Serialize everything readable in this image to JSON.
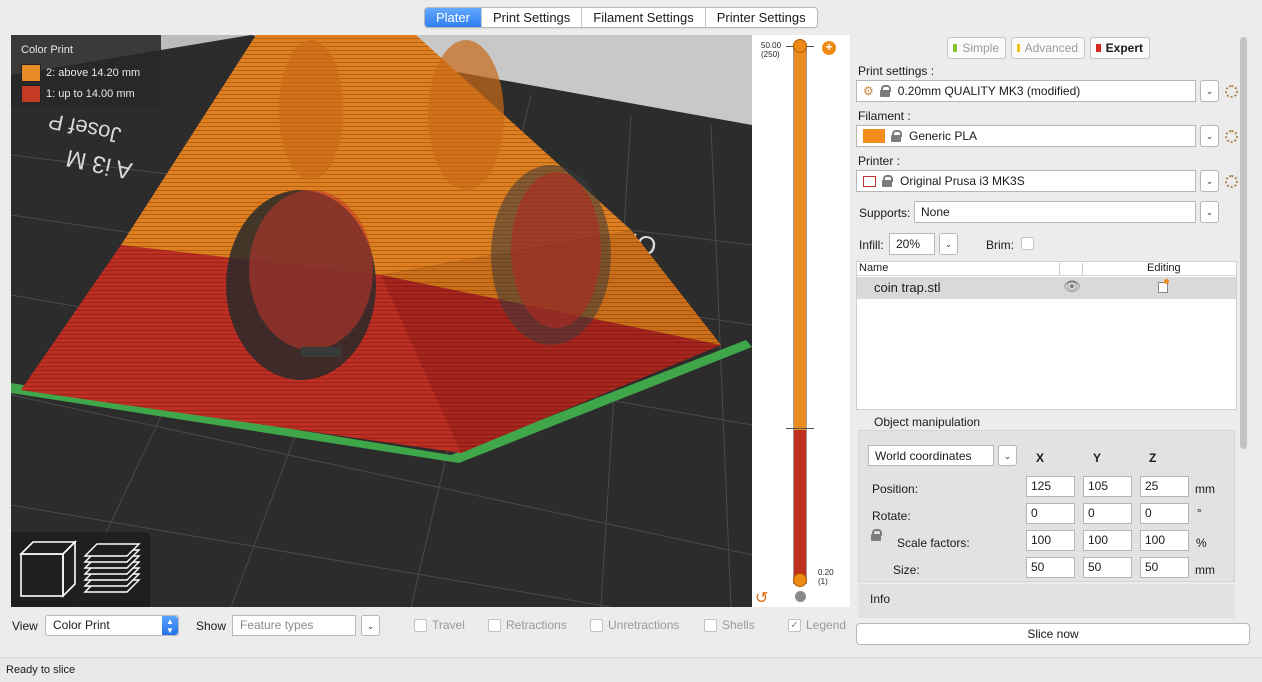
{
  "tabs": [
    "Plater",
    "Print Settings",
    "Filament Settings",
    "Printer Settings"
  ],
  "legend": {
    "title": "Color Print",
    "items": [
      {
        "label": "2: above 14.20 mm",
        "color": "#e88b26"
      },
      {
        "label": "1: up to 14.00 mm",
        "color": "#c33a25"
      }
    ]
  },
  "bed_texts": [
    "Original",
    "Josef P",
    "A i3 M"
  ],
  "slider": {
    "top_value": "50.00",
    "top_layer": "(250)",
    "bottom_value": "0.20",
    "bottom_layer": "(1)",
    "color_change_fraction": 0.714
  },
  "bottom": {
    "view_label": "View",
    "view_value": "Color Print",
    "show_label": "Show",
    "feature_placeholder": "Feature types",
    "checks": [
      {
        "label": "Travel",
        "checked": false
      },
      {
        "label": "Retractions",
        "checked": false
      },
      {
        "label": "Unretractions",
        "checked": false
      },
      {
        "label": "Shells",
        "checked": false
      },
      {
        "label": "Legend",
        "checked": true
      }
    ]
  },
  "modes": [
    {
      "label": "Simple",
      "color": "#8ac43b"
    },
    {
      "label": "Advanced",
      "color": "#f0c419"
    },
    {
      "label": "Expert",
      "color": "#d72b20"
    }
  ],
  "settings": {
    "print_label": "Print settings :",
    "print_value": "0.20mm QUALITY MK3 (modified)",
    "filament_label": "Filament :",
    "filament_value": "Generic PLA",
    "filament_color": "#f28c1b",
    "printer_label": "Printer :",
    "printer_value": "Original Prusa i3 MK3S",
    "supports_label": "Supports:",
    "supports_value": "None",
    "infill_label": "Infill:",
    "infill_value": "20%",
    "brim_label": "Brim:"
  },
  "objects": {
    "col_name": "Name",
    "col_editing": "Editing",
    "rows": [
      {
        "name": "coin trap.stl"
      }
    ]
  },
  "manipulation": {
    "title": "Object manipulation",
    "coords": "World coordinates",
    "axes": [
      "X",
      "Y",
      "Z"
    ],
    "position_label": "Position:",
    "position": [
      "125",
      "105",
      "25"
    ],
    "position_unit": "mm",
    "rotate_label": "Rotate:",
    "rotate": [
      "0",
      "0",
      "0"
    ],
    "rotate_unit": "°",
    "scale_label": "Scale factors:",
    "scale": [
      "100",
      "100",
      "100"
    ],
    "scale_unit": "%",
    "size_label": "Size:",
    "size": [
      "50",
      "50",
      "50"
    ],
    "size_unit": "mm"
  },
  "info": {
    "title": "Info"
  },
  "slice_button": "Slice now",
  "status": "Ready to slice"
}
